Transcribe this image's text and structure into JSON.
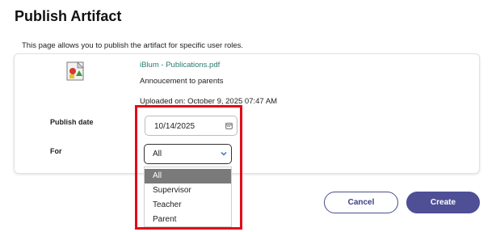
{
  "page": {
    "title": "Publish Artifact",
    "description": "This page allows you to publish the artifact for specific user roles."
  },
  "artifact": {
    "file_icon": "file-type-icon",
    "file_name": "iBlum - Publications.pdf",
    "message": "Annoucement to parents",
    "uploaded": "Uploaded on: October 9, 2025 07:47 AM"
  },
  "form": {
    "publish_date_label": "Publish date",
    "publish_date_value": "10/14/2025",
    "for_label": "For",
    "for_selected": "All",
    "for_options": [
      "All",
      "Supervisor",
      "Teacher",
      "Parent"
    ]
  },
  "actions": {
    "cancel": "Cancel",
    "create": "Create"
  },
  "colors": {
    "link": "#2a7b72",
    "primary": "#4f4f96",
    "highlight": "#e30b17",
    "selected_option": "#7a7a7a"
  }
}
